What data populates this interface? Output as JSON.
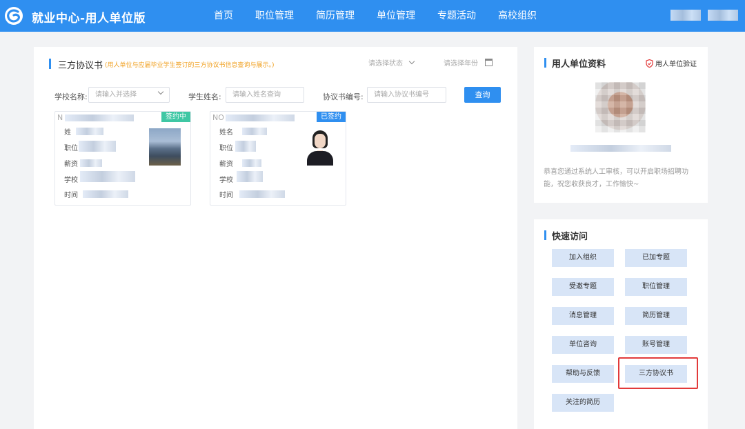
{
  "header": {
    "app_title": "就业中心-用人单位版",
    "nav": [
      "首页",
      "职位管理",
      "简历管理",
      "单位管理",
      "专题活动",
      "高校组织"
    ],
    "colors": {
      "primary": "#2f8ff0"
    }
  },
  "main": {
    "title": "三方协议书",
    "subtitle": "(用人单位与应届毕业学生签订的三方协议书信息查询与展示。)",
    "status_placeholder": "请选择状态",
    "year_placeholder": "请选择年份",
    "filters": {
      "school_label": "学校名称:",
      "school_placeholder": "请输入并选择",
      "student_label": "学生姓名:",
      "student_placeholder": "请输入姓名查询",
      "agreement_label": "协议书编号:",
      "agreement_placeholder": "请输入协议书编号",
      "search_label": "查询"
    },
    "cards": [
      {
        "no": "N",
        "status": "签约中",
        "fields": [
          "姓",
          "职位",
          "薪资",
          "学校",
          "时间"
        ]
      },
      {
        "no": "NO",
        "status": "已签约",
        "fields": [
          "姓名",
          "职位",
          "薪资",
          "学校",
          "时间"
        ]
      }
    ]
  },
  "profile": {
    "title": "用人单位资料",
    "verify": "用人单位验证",
    "desc": "恭喜您通过系统人工审核，可以开启职场招聘功能，祝您收获良才，工作愉快~"
  },
  "quick": {
    "title": "快速访问",
    "buttons": [
      "加入组织",
      "已加专题",
      "受邀专题",
      "职位管理",
      "消息管理",
      "简历管理",
      "单位咨询",
      "账号管理",
      "帮助与反馈",
      "三方协议书",
      "关注的简历"
    ]
  }
}
